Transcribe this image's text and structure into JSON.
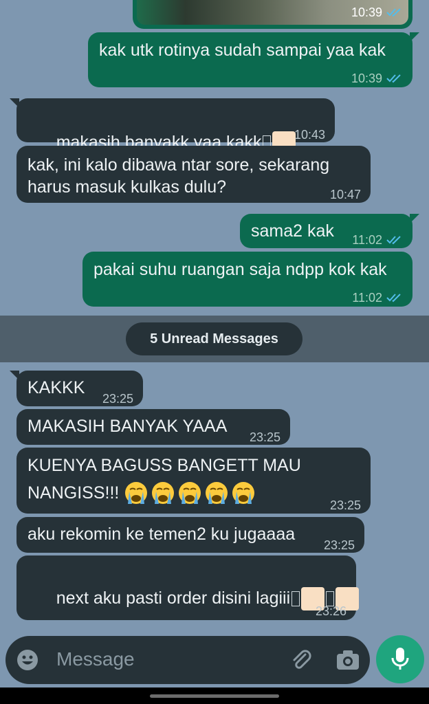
{
  "messages": [
    {
      "text": "kak utk rotinya sudah sampai yaa kak",
      "time": "10:39"
    },
    {
      "text": "makasih banyakk yaa kakk",
      "time": "10:43"
    },
    {
      "text_line1": "kak, ini kalo dibawa ntar sore, sekarang",
      "text_line2": "harus masuk kulkas dulu?",
      "time": "10:47"
    },
    {
      "text": "sama2 kak",
      "time": "11:02"
    },
    {
      "text": "pakai suhu ruangan saja ndpp kok kak",
      "time": "11:02"
    },
    {
      "text": "KAKKK",
      "time": "23:25"
    },
    {
      "text": "MAKASIH BANYAK YAAA",
      "time": "23:25"
    },
    {
      "text_line1": "KUENYA BAGUSS BANGETT MAU",
      "text_line2": "NANGISS!!!",
      "time": "23:25"
    },
    {
      "text": "aku rekomin ke temen2 ku jugaaaa",
      "time": "23:25"
    },
    {
      "text": "next aku pasti order disini lagiii",
      "time": "23:26"
    }
  ],
  "media_message": {
    "time": "10:39"
  },
  "unread_divider": "5 Unread Messages",
  "composer": {
    "placeholder": "Message"
  },
  "colors": {
    "chat_background": "#7e97b0",
    "outgoing_bubble": "#0b6a4f",
    "incoming_bubble": "#263238",
    "read_ticks": "#53bdeb",
    "mic_button": "#1fa57e"
  },
  "icons": [
    "double-check-icon",
    "crying-face-emoji",
    "emoji-icon",
    "attach-icon",
    "camera-icon",
    "mic-icon"
  ]
}
